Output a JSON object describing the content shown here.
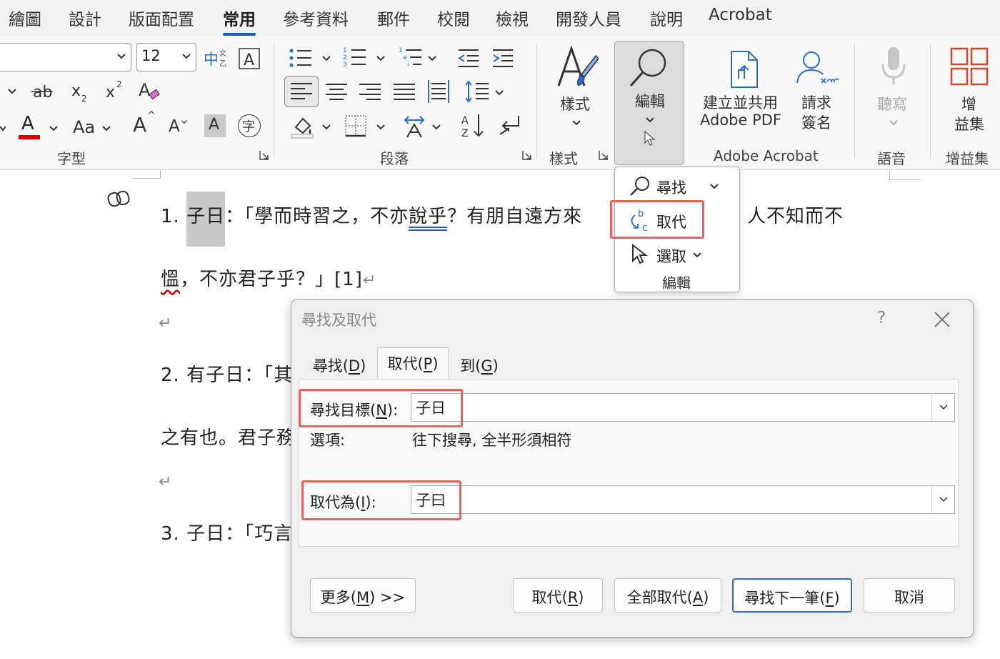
{
  "ribbon_tabs": [
    "繪圖",
    "設計",
    "版面配置",
    "常用",
    "參考資料",
    "郵件",
    "校閱",
    "檢視",
    "開發人員",
    "說明",
    "Acrobat"
  ],
  "active_tab": "常用",
  "font_group": {
    "label": "字型",
    "font_name": "",
    "font_size": "12",
    "change_case": "Aa",
    "grow_font": "A",
    "shrink_font": "A",
    "char_shading": "A",
    "enclose_char": "字",
    "font_color": "A",
    "font_color_hex": "#e00000"
  },
  "paragraph_group": {
    "label": "段落"
  },
  "styles_group": {
    "label": "樣式",
    "button_label": "樣式"
  },
  "editing_group": {
    "button_label": "編輯"
  },
  "acrobat_group": {
    "label": "Adobe Acrobat",
    "create_pdf_line1": "建立並共用",
    "create_pdf_line2": "Adobe PDF",
    "sign_line1": "請求",
    "sign_line2": "簽名"
  },
  "voice_group": {
    "label": "語音",
    "dictate": "聽寫"
  },
  "addins_group": {
    "label": "增益集",
    "button_line1": "增",
    "button_line2": "益集"
  },
  "edit_menu": {
    "find": "尋找",
    "replace": "取代",
    "select": "選取",
    "group_label": "編輯"
  },
  "document": {
    "line1_num": "1.",
    "line1_hl": "子日",
    "line1_a": "：「學而時習之，不亦",
    "line1_u": "說乎",
    "line1_b": "？有朋自遠方來",
    "line1_c": "人不知而不",
    "line2_u": "慍",
    "line2_rest": "，不亦君子乎？」[1]",
    "line3": "2.  有子日：「其",
    "line4": "之有也。君子務",
    "line5": "3.  子日：「巧言",
    "pilcrow": "↵"
  },
  "dialog": {
    "title": "尋找及取代",
    "help": "?",
    "tabs": [
      {
        "label": "尋找(",
        "key": "D"
      },
      {
        "label": "取代(",
        "key": "P"
      },
      {
        "label": "到(",
        "key": "G"
      }
    ],
    "find_label": "尋找目標(",
    "find_key": "N",
    "find_value": "子日",
    "options_label": "選項:",
    "options_value": "往下搜尋, 全半形須相符",
    "replace_label": "取代為(",
    "replace_key": "I",
    "replace_value": "子曰",
    "buttons": {
      "more": {
        "label": "更多(",
        "key": "M",
        "suffix": ") >>"
      },
      "replace": {
        "label": "取代(",
        "key": "R"
      },
      "replace_all": {
        "label": "全部取代(",
        "key": "A"
      },
      "find_next": {
        "label": "尋找下一筆(",
        "key": "F"
      },
      "cancel": "取消"
    },
    "close_paren": ")",
    "close_paren_colon": "):"
  },
  "highlight_color": "#e8615a",
  "accent_color": "#1a5fb4"
}
